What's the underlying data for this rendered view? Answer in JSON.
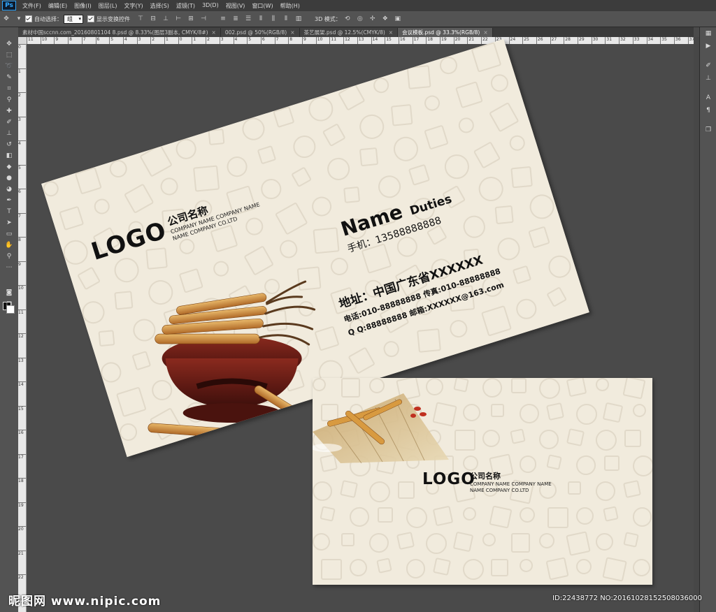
{
  "app": {
    "logo": "Ps"
  },
  "menu": [
    "文件(F)",
    "编辑(E)",
    "图像(I)",
    "图层(L)",
    "文字(Y)",
    "选择(S)",
    "滤镜(T)",
    "3D(D)",
    "视图(V)",
    "窗口(W)",
    "帮助(H)"
  ],
  "options": {
    "auto_select_label": "自动选择：",
    "auto_select_value": "组",
    "show_transform_label": "显示变换控件",
    "mode_3d_label": "3D 模式："
  },
  "tabs": [
    {
      "label": "素材中国sccnn.com_20160801104 8.psd @ 8.33%(图层3副本, CMYK/8#)",
      "active": false
    },
    {
      "label": "002.psd @ 50%(RGB/8)",
      "active": false
    },
    {
      "label": "茶艺展架.psd @ 12.5%(CMYK/8)",
      "active": false
    },
    {
      "label": "会议模板.psd @ 33.3%(RGB/8)",
      "active": true
    }
  ],
  "ruler_h": [
    "11",
    "10",
    "9",
    "8",
    "7",
    "6",
    "5",
    "4",
    "3",
    "2",
    "1",
    "0",
    "1",
    "2",
    "3",
    "4",
    "5",
    "6",
    "7",
    "8",
    "9",
    "10",
    "11",
    "12",
    "13",
    "14",
    "15",
    "16",
    "17",
    "18",
    "19",
    "20",
    "21",
    "22",
    "23",
    "24",
    "25",
    "26",
    "27",
    "28",
    "29",
    "30",
    "31",
    "32",
    "33",
    "34",
    "35",
    "36",
    "37"
  ],
  "ruler_v": [
    "0",
    "1",
    "2",
    "3",
    "4",
    "5",
    "6",
    "7",
    "8",
    "9",
    "10",
    "11",
    "12",
    "13",
    "14",
    "15",
    "16",
    "17",
    "18",
    "19",
    "20",
    "21",
    "22",
    "23"
  ],
  "card_front": {
    "logo": "LOGO",
    "company_name": "公司名称",
    "company_sub1": "COMPANY NAME COMPANY NAME",
    "company_sub2": "NAME COMPANY CO.LTD",
    "name": "Name",
    "duties": "Duties",
    "mobile": "手机：13588888888",
    "address": "地址：中国广东省XXXXXX",
    "phone_fax": "电话:010-88888888 传真:010-88888888",
    "qq_email": "Q Q:88888888 邮箱:XXXXXX@163.com"
  },
  "card_back": {
    "logo": "LOGO",
    "company_name": "公司名称",
    "company_sub1": "COMPANY NAME COMPANY NAME",
    "company_sub2": "NAME COMPANY CO.LTD"
  },
  "watermark": {
    "left": "昵图网 www.nipic.com",
    "right": "ID:22438772 NO:20161028152508036000"
  },
  "colors": {
    "card": "#f1ebdd",
    "canvas": "#4a4a4a",
    "panel": "#535353"
  }
}
